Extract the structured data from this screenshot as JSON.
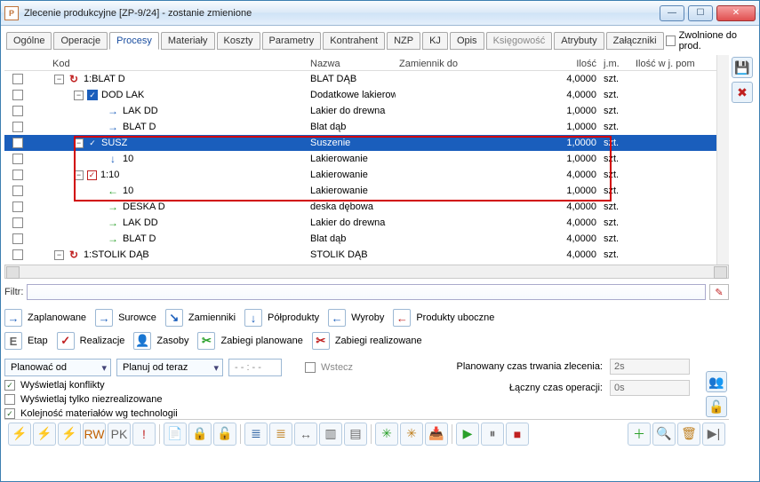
{
  "window": {
    "appiconLetter": "P",
    "title": "Zlecenie produkcyjne  [ZP-9/24] - zostanie zmienione"
  },
  "tabs": {
    "items": [
      "Ogólne",
      "Operacje",
      "Procesy",
      "Materiały",
      "Koszty",
      "Parametry",
      "Kontrahent",
      "NZP",
      "KJ",
      "Opis",
      "Księgowość",
      "Atrybuty",
      "Załączniki"
    ],
    "activeIndex": 2,
    "releaseLabel": "Zwolnione do prod."
  },
  "grid": {
    "headers": {
      "kod": "Kod",
      "nazwa": "Nazwa",
      "zamiennik": "Zamiennik do",
      "ilosc": "Ilość",
      "jm": "j.m.",
      "iloscjp": "Ilość w j. pom"
    },
    "rows": [
      {
        "indent": 0,
        "exp": "-",
        "icon": "recycle",
        "kod": "1:BLAT D",
        "nazwa": "BLAT DĄB",
        "ilosc": "4,0000",
        "jm": "szt.",
        "sel": false
      },
      {
        "indent": 1,
        "exp": "-",
        "icon": "check-blue",
        "kod": "DOD LAK",
        "nazwa": "Dodatkowe lakierowa",
        "ilosc": "4,0000",
        "jm": "szt.",
        "sel": false
      },
      {
        "indent": 2,
        "exp": "",
        "icon": "arrow-right-blue",
        "kod": "LAK DD",
        "nazwa": "Lakier do drewna",
        "ilosc": "1,0000",
        "jm": "szt.",
        "sel": false
      },
      {
        "indent": 2,
        "exp": "",
        "icon": "arrow-right-blue",
        "kod": "BLAT D",
        "nazwa": "Blat dąb",
        "ilosc": "1,0000",
        "jm": "szt.",
        "sel": false
      },
      {
        "indent": 1,
        "exp": "-",
        "icon": "check-blue",
        "kod": "SUSZ",
        "nazwa": "Suszenie",
        "ilosc": "1,0000",
        "jm": "szt.",
        "sel": true
      },
      {
        "indent": 2,
        "exp": "",
        "icon": "arrow-down-blue",
        "kod": "10",
        "nazwa": "Lakierowanie",
        "ilosc": "1,0000",
        "jm": "szt.",
        "sel": false
      },
      {
        "indent": 1,
        "exp": "-",
        "icon": "check-red",
        "kod": "1:10",
        "nazwa": "Lakierowanie",
        "ilosc": "4,0000",
        "jm": "szt.",
        "sel": false
      },
      {
        "indent": 2,
        "exp": "",
        "icon": "arrow-left-green",
        "kod": "10",
        "nazwa": "Lakierowanie",
        "ilosc": "1,0000",
        "jm": "szt.",
        "sel": false
      },
      {
        "indent": 2,
        "exp": "",
        "icon": "arrow-right-green",
        "kod": "DESKA D",
        "nazwa": "deska dębowa",
        "ilosc": "4,0000",
        "jm": "szt.",
        "sel": false
      },
      {
        "indent": 2,
        "exp": "",
        "icon": "arrow-right-green",
        "kod": "LAK DD",
        "nazwa": "Lakier do drewna",
        "ilosc": "4,0000",
        "jm": "szt.",
        "sel": false
      },
      {
        "indent": 2,
        "exp": "",
        "icon": "arrow-right-green",
        "kod": "BLAT D",
        "nazwa": "Blat dąb",
        "ilosc": "4,0000",
        "jm": "szt.",
        "sel": false
      },
      {
        "indent": 0,
        "exp": "-",
        "icon": "recycle",
        "kod": "1:STOLIK DĄB",
        "nazwa": "STOLIK DĄB",
        "ilosc": "4,0000",
        "jm": "szt.",
        "sel": false
      }
    ]
  },
  "filter": {
    "label": "Filtr:",
    "value": ""
  },
  "legend": {
    "row1": [
      {
        "color": "#1a5ebc",
        "glyph": "→",
        "text": "Zaplanowane"
      },
      {
        "color": "#1a5ebc",
        "glyph": "→",
        "text": "Surowce"
      },
      {
        "color": "#1a5ebc",
        "glyph": "↘",
        "text": "Zamienniki"
      },
      {
        "color": "#1a5ebc",
        "glyph": "↓",
        "text": "Półprodukty"
      },
      {
        "color": "#1a5ebc",
        "glyph": "←",
        "text": "Wyroby"
      },
      {
        "color": "#c02020",
        "glyph": "←",
        "text": "Produkty uboczne"
      }
    ],
    "row2": [
      {
        "color": "#666",
        "glyph": "E",
        "text": "Etap"
      },
      {
        "color": "#c02020",
        "glyph": "✓",
        "text": "Realizacje"
      },
      {
        "color": "#c08020",
        "glyph": "👤",
        "text": "Zasoby"
      },
      {
        "color": "#2aa02a",
        "glyph": "✂",
        "text": "Zabiegi planowane"
      },
      {
        "color": "#c02020",
        "glyph": "✂",
        "text": "Zabiegi realizowane"
      }
    ]
  },
  "plan": {
    "comboLabel": "Planować od",
    "fromValue": "Planuj od teraz",
    "timeValue": "- - : - -",
    "backLabel": "Wstecz",
    "checks": {
      "conflicts": "Wyświetlaj konflikty",
      "unrealized": "Wyświetlaj tylko niezrealizowane",
      "techorder": "Kolejność materiałów wg technologii"
    },
    "right": {
      "durLabel": "Planowany czas trwania zlecenia:",
      "durVal": "2s",
      "opLabel": "Łączny czas operacji:",
      "opVal": "0s"
    }
  },
  "toolbar": {
    "btns": [
      {
        "g": "⚡",
        "c": "#d8a000"
      },
      {
        "g": "⚡",
        "c": "#2aa02a"
      },
      {
        "g": "⚡",
        "c": "#c02020"
      },
      {
        "g": "RW",
        "c": "#c06000"
      },
      {
        "g": "PK",
        "c": "#666"
      },
      {
        "g": "!",
        "c": "#c02020"
      },
      {
        "g": "📄",
        "c": "#c08020"
      },
      {
        "g": "🔒",
        "c": "#2aa02a"
      },
      {
        "g": "🔓",
        "c": "#888"
      },
      {
        "g": "≣",
        "c": "#2a60a0"
      },
      {
        "g": "≣",
        "c": "#c08020"
      },
      {
        "g": "↔",
        "c": "#666"
      },
      {
        "g": "▥",
        "c": "#666"
      },
      {
        "g": "▤",
        "c": "#666"
      },
      {
        "g": "✳",
        "c": "#2aa02a"
      },
      {
        "g": "✳",
        "c": "#c08020"
      },
      {
        "g": "📥",
        "c": "#2a60a0"
      },
      {
        "g": "▶",
        "c": "#2aa02a"
      },
      {
        "g": "⏸",
        "c": "#666"
      },
      {
        "g": "■",
        "c": "#c02020"
      }
    ],
    "right": [
      {
        "g": "＋",
        "c": "#2aa02a"
      },
      {
        "g": "🔍",
        "c": "#666"
      },
      {
        "g": "🗑",
        "c": "#c08020"
      },
      {
        "g": "▶|",
        "c": "#666"
      }
    ]
  }
}
